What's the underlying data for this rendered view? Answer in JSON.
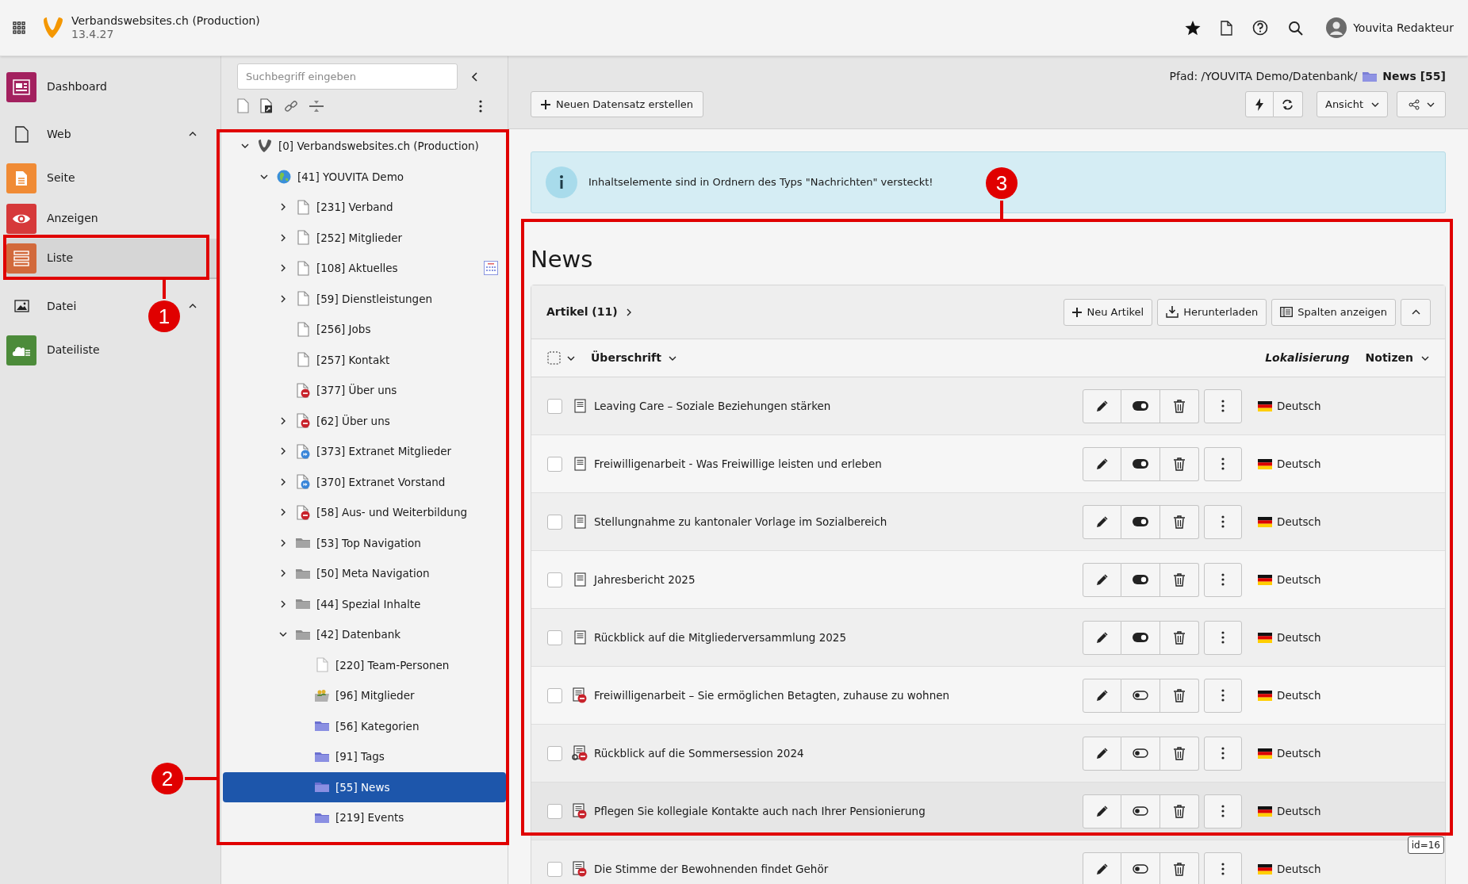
{
  "topbar": {
    "site_title": "Verbandswebsites.ch (Production)",
    "version": "13.4.27",
    "user": "Youvita Redakteur"
  },
  "modules": [
    {
      "kind": "module",
      "label": "Dashboard",
      "color": "#a3215f",
      "selected": false
    },
    {
      "kind": "group",
      "label": "Web",
      "expanded": true
    },
    {
      "kind": "module",
      "label": "Seite",
      "color": "#f08b35",
      "selected": false
    },
    {
      "kind": "module",
      "label": "Anzeigen",
      "color": "#d6393a",
      "selected": false
    },
    {
      "kind": "module",
      "label": "Liste",
      "color": "#d2693b",
      "selected": true
    },
    {
      "kind": "group",
      "label": "Datei",
      "expanded": true
    },
    {
      "kind": "module",
      "label": "Dateiliste",
      "color": "#4c8b3a",
      "selected": false
    }
  ],
  "tree_panel": {
    "search": {
      "placeholder": "Suchbegriff eingeben"
    },
    "tree": [
      {
        "kind": "root",
        "label": "[0] Verbandswebsites.ch (Production)",
        "expandable": true,
        "expanded": true,
        "calendar_badge": false,
        "selected": false,
        "children": [
          {
            "kind": "site",
            "label": "[41] YOUVITA Demo",
            "expandable": true,
            "expanded": true,
            "calendar_badge": false,
            "selected": false,
            "children": [
              {
                "kind": "page",
                "label": "[231] Verband",
                "expandable": true,
                "expanded": false,
                "calendar_badge": false,
                "selected": false
              },
              {
                "kind": "page",
                "label": "[252] Mitglieder",
                "expandable": true,
                "expanded": false,
                "calendar_badge": false,
                "selected": false
              },
              {
                "kind": "page",
                "label": "[108] Aktuelles",
                "expandable": true,
                "expanded": false,
                "calendar_badge": true,
                "selected": false
              },
              {
                "kind": "page",
                "label": "[59] Dienstleistungen",
                "expandable": true,
                "expanded": false,
                "calendar_badge": false,
                "selected": false
              },
              {
                "kind": "page",
                "label": "[256] Jobs",
                "expandable": false,
                "calendar_badge": false,
                "selected": false
              },
              {
                "kind": "page",
                "label": "[257] Kontakt",
                "expandable": false,
                "calendar_badge": false,
                "selected": false
              },
              {
                "kind": "page-hidden",
                "label": "[377] Über uns",
                "expandable": false,
                "calendar_badge": false,
                "selected": false
              },
              {
                "kind": "page-hidden",
                "label": "[62] Über uns",
                "expandable": true,
                "expanded": false,
                "calendar_badge": false,
                "selected": false
              },
              {
                "kind": "page-shortcut",
                "label": "[373] Extranet Mitglieder",
                "expandable": true,
                "expanded": false,
                "calendar_badge": false,
                "selected": false
              },
              {
                "kind": "page-shortcut",
                "label": "[370] Extranet Vorstand",
                "expandable": true,
                "expanded": false,
                "calendar_badge": false,
                "selected": false
              },
              {
                "kind": "page-hidden",
                "label": "[58] Aus- und Weiterbildung",
                "expandable": true,
                "expanded": false,
                "calendar_badge": false,
                "selected": false
              },
              {
                "kind": "folder",
                "label": "[53] Top Navigation",
                "expandable": true,
                "expanded": false,
                "calendar_badge": false,
                "selected": false
              },
              {
                "kind": "folder",
                "label": "[50] Meta Navigation",
                "expandable": true,
                "expanded": false,
                "calendar_badge": false,
                "selected": false
              },
              {
                "kind": "folder",
                "label": "[44] Spezial Inhalte",
                "expandable": true,
                "expanded": false,
                "calendar_badge": false,
                "selected": false
              },
              {
                "kind": "folder",
                "label": "[42] Datenbank",
                "expandable": true,
                "expanded": true,
                "calendar_badge": false,
                "selected": false,
                "children": [
                  {
                    "kind": "page-light",
                    "label": "[220] Team-Personen",
                    "expandable": false,
                    "calendar_badge": false,
                    "selected": false
                  },
                  {
                    "kind": "folder-users",
                    "label": "[96] Mitglieder",
                    "expandable": false,
                    "calendar_badge": false,
                    "selected": false
                  },
                  {
                    "kind": "sysfolder",
                    "label": "[56] Kategorien",
                    "expandable": false,
                    "calendar_badge": false,
                    "selected": false
                  },
                  {
                    "kind": "sysfolder",
                    "label": "[91] Tags",
                    "expandable": false,
                    "calendar_badge": false,
                    "selected": false
                  },
                  {
                    "kind": "sysfolder",
                    "label": "[55] News",
                    "expandable": false,
                    "calendar_badge": false,
                    "selected": true
                  },
                  {
                    "kind": "sysfolder",
                    "label": "[219] Events",
                    "expandable": false,
                    "calendar_badge": false,
                    "selected": false
                  }
                ]
              }
            ]
          }
        ]
      }
    ]
  },
  "content": {
    "path": "Pfad: /YOUVITA Demo/Datenbank/",
    "path_page": "News [55]",
    "new_record_button": "Neuen Datensatz erstellen",
    "view_button": "Ansicht",
    "info": "Inhaltselemente sind in Ordnern des Typs \"Nachrichten\" versteckt!",
    "heading": "News",
    "table": {
      "title": "Artikel (11)",
      "buttons": [
        "Neu Artikel",
        "Herunterladen",
        "Spalten anzeigen"
      ],
      "columns": [
        "Überschrift",
        "Lokalisierung",
        "Notizen"
      ],
      "rows": [
        {
          "kind": "record",
          "title": "Leaving Care – Soziale Beziehungen stärken",
          "hidden": false,
          "language": "Deutsch",
          "hovered": false
        },
        {
          "kind": "record",
          "title": "Freiwilligenarbeit - Was Freiwillige leisten und erleben",
          "hidden": false,
          "language": "Deutsch",
          "hovered": false
        },
        {
          "kind": "record",
          "title": "Stellungnahme zu kantonaler Vorlage im Sozialbereich",
          "hidden": false,
          "language": "Deutsch",
          "hovered": false
        },
        {
          "kind": "record",
          "title": "Jahresbericht 2025",
          "hidden": false,
          "language": "Deutsch",
          "hovered": false
        },
        {
          "kind": "record",
          "title": "Rückblick auf die Mitgliederversammlung 2025",
          "hidden": false,
          "language": "Deutsch",
          "hovered": false
        },
        {
          "kind": "record-hidden",
          "title": "Freiwilligenarbeit – Sie ermöglichen Betagten, zuhause zu wohnen",
          "hidden": true,
          "language": "Deutsch",
          "hovered": false
        },
        {
          "kind": "record-hidden-linked",
          "title": "Rückblick auf die Sommersession 2024",
          "hidden": true,
          "language": "Deutsch",
          "hovered": false
        },
        {
          "kind": "record-hidden",
          "title": "Pflegen Sie kollegiale Kontakte auch nach Ihrer Pensionierung",
          "hidden": true,
          "language": "Deutsch",
          "hovered": true
        },
        {
          "kind": "record-hidden",
          "title": "Die Stimme der Bewohnenden findet Gehör",
          "hidden": true,
          "language": "Deutsch",
          "hovered": false
        }
      ],
      "tooltip": "id=16"
    }
  },
  "annotations": [
    {
      "label": "1"
    },
    {
      "label": "2"
    },
    {
      "label": "3"
    }
  ]
}
